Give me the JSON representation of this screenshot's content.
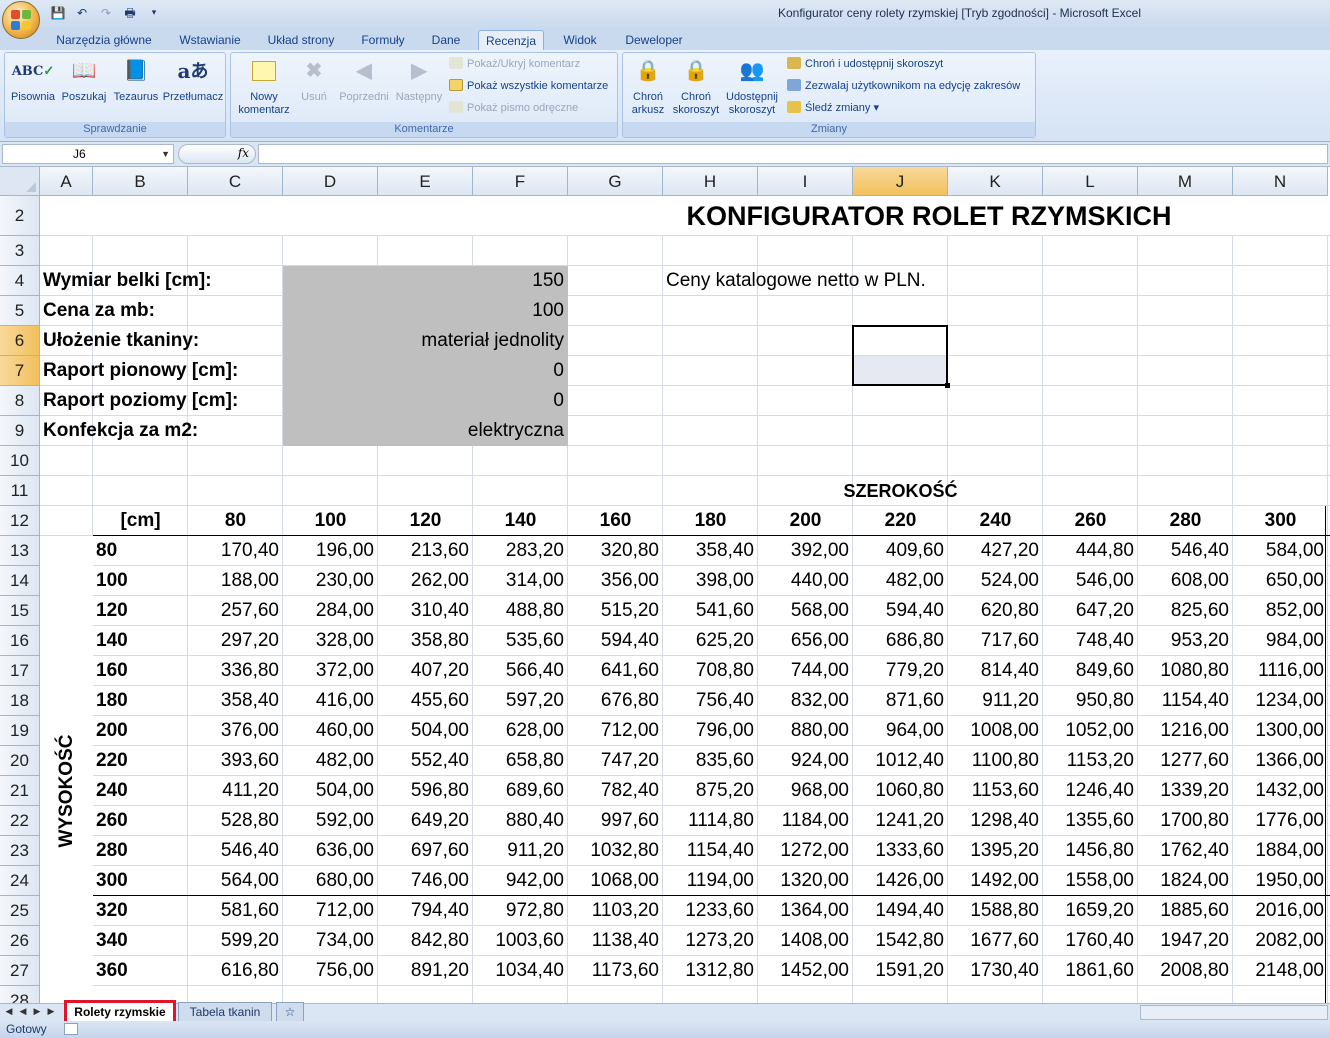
{
  "window": {
    "title": "Konfigurator ceny rolety rzymskiej  [Tryb zgodności] - Microsoft Excel"
  },
  "ribbon": {
    "tabs": [
      "Narzędzia główne",
      "Wstawianie",
      "Układ strony",
      "Formuły",
      "Dane",
      "Recenzja",
      "Widok",
      "Deweloper"
    ],
    "active_tab": "Recenzja",
    "groups": {
      "sprawdzanie": {
        "label": "Sprawdzanie",
        "buttons": [
          "Pisownia",
          "Poszukaj",
          "Tezaurus",
          "Przetłumacz"
        ]
      },
      "komentarze": {
        "label": "Komentarze",
        "new_comment": [
          "Nowy",
          "komentarz"
        ],
        "delete": "Usuń",
        "previous": "Poprzedni",
        "next": "Następny",
        "show_hide": "Pokaż/Ukryj komentarz",
        "show_all": "Pokaż wszystkie komentarze",
        "show_ink": "Pokaż pismo odręczne"
      },
      "zmiany": {
        "label": "Zmiany",
        "protect_sheet": [
          "Chroń",
          "arkusz"
        ],
        "protect_workbook": [
          "Chroń",
          "skoroszyt"
        ],
        "share_workbook": [
          "Udostępnij",
          "skoroszyt"
        ],
        "protect_share": "Chroń i udostępnij skoroszyt",
        "allow_edit": "Zezwalaj użytkownikom na edycję zakresów",
        "track_changes": "Śledź zmiany ▾"
      }
    }
  },
  "formula_bar": {
    "name_box": "J6",
    "fx": "fx",
    "value": ""
  },
  "grid": {
    "columns": [
      "A",
      "B",
      "C",
      "D",
      "E",
      "F",
      "G",
      "H",
      "I",
      "J",
      "K",
      "L",
      "M",
      "N"
    ],
    "rows": [
      "2",
      "3",
      "4",
      "5",
      "6",
      "7",
      "8",
      "9",
      "10",
      "11",
      "12",
      "13",
      "14",
      "15",
      "16",
      "17",
      "18",
      "19",
      "20",
      "21",
      "22",
      "23",
      "24",
      "25",
      "26",
      "27",
      "28"
    ],
    "selected_column": "J",
    "selected_rows": [
      "6",
      "7"
    ]
  },
  "sheet": {
    "title": "KONFIGURATOR ROLET RZYMSKICH",
    "note": "Ceny katalogowe netto w PLN.",
    "params": [
      {
        "label": "Wymiar belki [cm]:",
        "value": "150"
      },
      {
        "label": "Cena za mb:",
        "value": "100"
      },
      {
        "label": "Ułożenie tkaniny:",
        "value": "materiał jednolity"
      },
      {
        "label": "Raport pionowy [cm]:",
        "value": "0"
      },
      {
        "label": "Raport poziomy [cm]:",
        "value": "0"
      },
      {
        "label": "Konfekcja za m2:",
        "value": "elektryczna"
      }
    ],
    "width_label": "SZEROKOŚĆ",
    "height_label": "WYSOKOŚĆ",
    "unit_label": "[cm]",
    "widths": [
      "80",
      "100",
      "120",
      "140",
      "160",
      "180",
      "200",
      "220",
      "240",
      "260",
      "280",
      "300"
    ],
    "table": [
      {
        "h": "80",
        "v": [
          "170,40",
          "196,00",
          "213,60",
          "283,20",
          "320,80",
          "358,40",
          "392,00",
          "409,60",
          "427,20",
          "444,80",
          "546,40",
          "584,00"
        ]
      },
      {
        "h": "100",
        "v": [
          "188,00",
          "230,00",
          "262,00",
          "314,00",
          "356,00",
          "398,00",
          "440,00",
          "482,00",
          "524,00",
          "546,00",
          "608,00",
          "650,00"
        ]
      },
      {
        "h": "120",
        "v": [
          "257,60",
          "284,00",
          "310,40",
          "488,80",
          "515,20",
          "541,60",
          "568,00",
          "594,40",
          "620,80",
          "647,20",
          "825,60",
          "852,00"
        ]
      },
      {
        "h": "140",
        "v": [
          "297,20",
          "328,00",
          "358,80",
          "535,60",
          "594,40",
          "625,20",
          "656,00",
          "686,80",
          "717,60",
          "748,40",
          "953,20",
          "984,00"
        ]
      },
      {
        "h": "160",
        "v": [
          "336,80",
          "372,00",
          "407,20",
          "566,40",
          "641,60",
          "708,80",
          "744,00",
          "779,20",
          "814,40",
          "849,60",
          "1080,80",
          "1116,00"
        ]
      },
      {
        "h": "180",
        "v": [
          "358,40",
          "416,00",
          "455,60",
          "597,20",
          "676,80",
          "756,40",
          "832,00",
          "871,60",
          "911,20",
          "950,80",
          "1154,40",
          "1234,00"
        ]
      },
      {
        "h": "200",
        "v": [
          "376,00",
          "460,00",
          "504,00",
          "628,00",
          "712,00",
          "796,00",
          "880,00",
          "964,00",
          "1008,00",
          "1052,00",
          "1216,00",
          "1300,00"
        ]
      },
      {
        "h": "220",
        "v": [
          "393,60",
          "482,00",
          "552,40",
          "658,80",
          "747,20",
          "835,60",
          "924,00",
          "1012,40",
          "1100,80",
          "1153,20",
          "1277,60",
          "1366,00"
        ]
      },
      {
        "h": "240",
        "v": [
          "411,20",
          "504,00",
          "596,80",
          "689,60",
          "782,40",
          "875,20",
          "968,00",
          "1060,80",
          "1153,60",
          "1246,40",
          "1339,20",
          "1432,00"
        ]
      },
      {
        "h": "260",
        "v": [
          "528,80",
          "592,00",
          "649,20",
          "880,40",
          "997,60",
          "1114,80",
          "1184,00",
          "1241,20",
          "1298,40",
          "1355,60",
          "1700,80",
          "1776,00"
        ]
      },
      {
        "h": "280",
        "v": [
          "546,40",
          "636,00",
          "697,60",
          "911,20",
          "1032,80",
          "1154,40",
          "1272,00",
          "1333,60",
          "1395,20",
          "1456,80",
          "1762,40",
          "1884,00"
        ]
      },
      {
        "h": "300",
        "v": [
          "564,00",
          "680,00",
          "746,00",
          "942,00",
          "1068,00",
          "1194,00",
          "1320,00",
          "1426,00",
          "1492,00",
          "1558,00",
          "1824,00",
          "1950,00"
        ]
      },
      {
        "h": "320",
        "v": [
          "581,60",
          "712,00",
          "794,40",
          "972,80",
          "1103,20",
          "1233,60",
          "1364,00",
          "1494,40",
          "1588,80",
          "1659,20",
          "1885,60",
          "2016,00"
        ]
      },
      {
        "h": "340",
        "v": [
          "599,20",
          "734,00",
          "842,80",
          "1003,60",
          "1138,40",
          "1273,20",
          "1408,00",
          "1542,80",
          "1677,60",
          "1760,40",
          "1947,20",
          "2082,00"
        ]
      },
      {
        "h": "360",
        "v": [
          "616,80",
          "756,00",
          "891,20",
          "1034,40",
          "1173,60",
          "1312,80",
          "1452,00",
          "1591,20",
          "1730,40",
          "1861,60",
          "2008,80",
          "2148,00"
        ]
      }
    ]
  },
  "sheet_tabs": [
    "Rolety rzymskie",
    "Tabela tkanin"
  ],
  "active_sheet": "Rolety rzymskie",
  "status": {
    "text": "Gotowy"
  },
  "colors": {
    "param_bg": "#bfbfbf",
    "selection_border": "#000000",
    "highlight": "#e0152a"
  }
}
